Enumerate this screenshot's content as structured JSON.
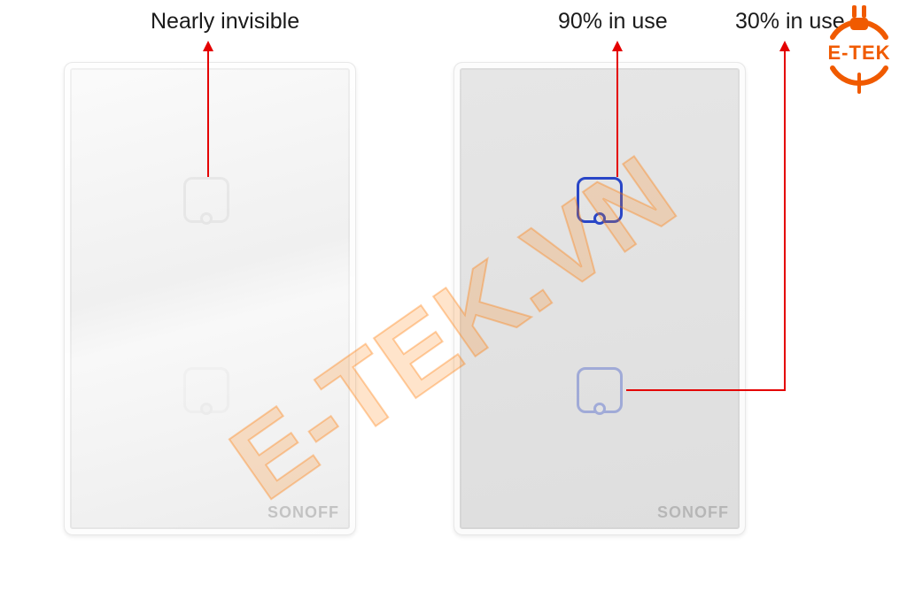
{
  "labels": {
    "left": "Nearly invisible",
    "right_top": "90% in use",
    "right_bottom": "30% in use"
  },
  "panel_brand": "SONOFF",
  "watermark_text": "E-TEK.VN",
  "logo_text": "E-TEK"
}
